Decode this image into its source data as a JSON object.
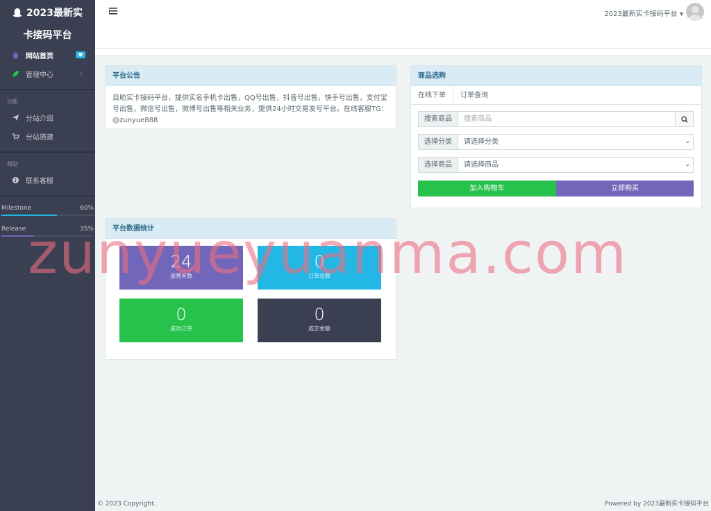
{
  "sidebar": {
    "brand_title": "2023最新实",
    "brand_subtitle": "卡接码平台",
    "items": [
      {
        "label": "网站首页",
        "badge": "♥"
      },
      {
        "label": "管理中心",
        "chevron": "›"
      }
    ],
    "section_function": "功能",
    "function_items": [
      {
        "label": "分站介绍"
      },
      {
        "label": "分站搭建"
      }
    ],
    "section_help": "帮助",
    "help_items": [
      {
        "label": "联系客服"
      }
    ],
    "progress": [
      {
        "label": "Milestone",
        "value_text": "60%",
        "value": 60,
        "color": "#23b7e5"
      },
      {
        "label": "Release",
        "value_text": "35%",
        "value": 35,
        "color": "#7266ba"
      }
    ]
  },
  "header": {
    "user_name": "2023最新实卡接码平台",
    "caret": "▾"
  },
  "announcement": {
    "title": "平台公告",
    "body": "自助实卡接码平台，提供实名手机卡出售，QQ号出售，抖音号出售，快手号出售，支付宝号出售，微信号出售，微博号出售等相关业务，提供24小时交易发号平台。在线客服TG：@zunyue888"
  },
  "shop": {
    "title": "商品选购",
    "tabs": [
      "在线下单",
      "订单查询"
    ],
    "search_label": "搜索商品",
    "search_placeholder": "搜索商品",
    "category_label": "选择分类",
    "category_value": "请选择分类",
    "product_label": "选择商品",
    "product_value": "请选择商品",
    "add_cart_label": "加入购物车",
    "buy_now_label": "立即购买"
  },
  "stats": {
    "title": "平台数据统计",
    "cards": [
      {
        "value": "24",
        "label": "运营天数",
        "color": "#7266ba"
      },
      {
        "value": "0",
        "label": "订单总数",
        "color": "#23b7e5"
      },
      {
        "value": "0",
        "label": "成功订单",
        "color": "#27c24c"
      },
      {
        "value": "0",
        "label": "成交金额",
        "color": "#3a3f51"
      }
    ]
  },
  "watermark": "zunyueyuanma.com",
  "footer": {
    "copyright": "© 2023 Copyright.",
    "powered": "Powered by 2023最新实卡接码平台"
  },
  "icons": [
    "tux-icon",
    "home-icon",
    "leaf-icon",
    "send-icon",
    "cart-icon",
    "info-icon",
    "menu-icon",
    "search-icon"
  ]
}
